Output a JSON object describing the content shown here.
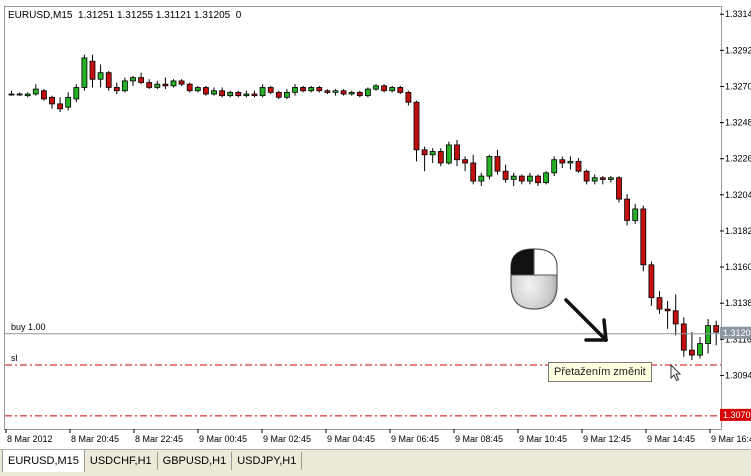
{
  "chart_data": {
    "type": "candlestick",
    "title": "EURUSD,M15  1.31251 1.31255 1.31121 1.31205  0",
    "symbol": "EURUSD",
    "timeframe": "M15",
    "ohlc_info": "1.31251 1.31255 1.31121 1.31205  0",
    "price_ticks": [
      "1.3314",
      "1.3292",
      "1.3270",
      "1.3248",
      "1.3226",
      "1.3204",
      "1.3182",
      "1.3160",
      "1.3138",
      "1.3116",
      "1.3094"
    ],
    "ylim": [
      1.3062,
      1.3319
    ],
    "time_ticks": [
      "8 Mar 2012",
      "8 Mar 20:45",
      "8 Mar 22:45",
      "9 Mar 00:45",
      "9 Mar 02:45",
      "9 Mar 04:45",
      "9 Mar 06:45",
      "9 Mar 08:45",
      "9 Mar 10:45",
      "9 Mar 12:45",
      "9 Mar 14:45",
      "9 Mar 16:45"
    ],
    "candles": [
      [
        1.3266,
        1.3268,
        1.3265,
        1.3266
      ],
      [
        1.3266,
        1.3267,
        1.3265,
        1.3266
      ],
      [
        1.3265,
        1.3267,
        1.3264,
        1.3266
      ],
      [
        1.3266,
        1.3272,
        1.3265,
        1.3269
      ],
      [
        1.3268,
        1.3269,
        1.3262,
        1.3263
      ],
      [
        1.3264,
        1.3265,
        1.3257,
        1.326
      ],
      [
        1.326,
        1.3264,
        1.3255,
        1.3257
      ],
      [
        1.3258,
        1.3267,
        1.3256,
        1.3264
      ],
      [
        1.3263,
        1.3272,
        1.3261,
        1.327
      ],
      [
        1.327,
        1.329,
        1.3268,
        1.3288
      ],
      [
        1.3286,
        1.329,
        1.327,
        1.3275
      ],
      [
        1.3275,
        1.3284,
        1.327,
        1.3279
      ],
      [
        1.3279,
        1.328,
        1.3268,
        1.327
      ],
      [
        1.327,
        1.3273,
        1.3266,
        1.3268
      ],
      [
        1.3268,
        1.3276,
        1.3267,
        1.3274
      ],
      [
        1.3274,
        1.3277,
        1.3271,
        1.3276
      ],
      [
        1.3276,
        1.3279,
        1.3272,
        1.3273
      ],
      [
        1.3273,
        1.3275,
        1.3269,
        1.327
      ],
      [
        1.327,
        1.3274,
        1.3269,
        1.3272
      ],
      [
        1.3272,
        1.3276,
        1.3269,
        1.3271
      ],
      [
        1.3271,
        1.3275,
        1.327,
        1.3274
      ],
      [
        1.3274,
        1.3275,
        1.3271,
        1.3272
      ],
      [
        1.3272,
        1.3273,
        1.3267,
        1.3268
      ],
      [
        1.3268,
        1.3271,
        1.3267,
        1.327
      ],
      [
        1.327,
        1.3271,
        1.3265,
        1.3266
      ],
      [
        1.3266,
        1.327,
        1.3265,
        1.3268
      ],
      [
        1.3268,
        1.327,
        1.3264,
        1.3265
      ],
      [
        1.3265,
        1.3268,
        1.3264,
        1.3267
      ],
      [
        1.3267,
        1.3268,
        1.3264,
        1.3265
      ],
      [
        1.3265,
        1.3268,
        1.3264,
        1.3266
      ],
      [
        1.3266,
        1.3268,
        1.3264,
        1.3265
      ],
      [
        1.3265,
        1.3272,
        1.3264,
        1.327
      ],
      [
        1.327,
        1.3271,
        1.3266,
        1.3267
      ],
      [
        1.3267,
        1.3268,
        1.3263,
        1.3264
      ],
      [
        1.3264,
        1.3269,
        1.3263,
        1.3267
      ],
      [
        1.3267,
        1.3272,
        1.3265,
        1.327
      ],
      [
        1.327,
        1.3271,
        1.3267,
        1.3268
      ],
      [
        1.3268,
        1.3271,
        1.3267,
        1.327
      ],
      [
        1.327,
        1.3271,
        1.3267,
        1.3268
      ],
      [
        1.3268,
        1.3269,
        1.3266,
        1.3267
      ],
      [
        1.3267,
        1.3269,
        1.3265,
        1.3268
      ],
      [
        1.3268,
        1.3269,
        1.3265,
        1.3266
      ],
      [
        1.3266,
        1.3268,
        1.3265,
        1.3267
      ],
      [
        1.3267,
        1.3268,
        1.3264,
        1.3265
      ],
      [
        1.3265,
        1.327,
        1.3264,
        1.3269
      ],
      [
        1.3269,
        1.3272,
        1.3268,
        1.3271
      ],
      [
        1.3271,
        1.3272,
        1.3267,
        1.3268
      ],
      [
        1.3268,
        1.3271,
        1.3267,
        1.327
      ],
      [
        1.327,
        1.3271,
        1.3266,
        1.3267
      ],
      [
        1.3267,
        1.3268,
        1.3259,
        1.3261
      ],
      [
        1.3261,
        1.3262,
        1.3225,
        1.3232
      ],
      [
        1.3232,
        1.3234,
        1.3219,
        1.3229
      ],
      [
        1.3229,
        1.3233,
        1.3224,
        1.3231
      ],
      [
        1.3231,
        1.3233,
        1.3222,
        1.3224
      ],
      [
        1.3224,
        1.3237,
        1.3223,
        1.3235
      ],
      [
        1.3235,
        1.3238,
        1.3222,
        1.3226
      ],
      [
        1.3226,
        1.3228,
        1.3219,
        1.3224
      ],
      [
        1.3224,
        1.3229,
        1.3211,
        1.3213
      ],
      [
        1.3213,
        1.3218,
        1.321,
        1.3216
      ],
      [
        1.3216,
        1.3229,
        1.3214,
        1.3228
      ],
      [
        1.3228,
        1.3232,
        1.3217,
        1.3219
      ],
      [
        1.3219,
        1.3223,
        1.3212,
        1.3214
      ],
      [
        1.3214,
        1.3218,
        1.321,
        1.3216
      ],
      [
        1.3216,
        1.3217,
        1.3211,
        1.3213
      ],
      [
        1.3213,
        1.3218,
        1.3211,
        1.3216
      ],
      [
        1.3216,
        1.3217,
        1.321,
        1.3212
      ],
      [
        1.3212,
        1.3219,
        1.3211,
        1.3218
      ],
      [
        1.3218,
        1.3228,
        1.3216,
        1.3226
      ],
      [
        1.3226,
        1.3228,
        1.3221,
        1.3224
      ],
      [
        1.3224,
        1.3228,
        1.322,
        1.3225
      ],
      [
        1.3225,
        1.3227,
        1.3218,
        1.3219
      ],
      [
        1.3219,
        1.322,
        1.3211,
        1.3213
      ],
      [
        1.3213,
        1.3217,
        1.3211,
        1.3215
      ],
      [
        1.3215,
        1.3216,
        1.3211,
        1.3214
      ],
      [
        1.3214,
        1.3216,
        1.3212,
        1.3215
      ],
      [
        1.3215,
        1.3216,
        1.32,
        1.3202
      ],
      [
        1.3202,
        1.3205,
        1.3186,
        1.3189
      ],
      [
        1.3189,
        1.3199,
        1.3187,
        1.3196
      ],
      [
        1.3196,
        1.3198,
        1.3158,
        1.3162
      ],
      [
        1.3162,
        1.3164,
        1.3137,
        1.3142
      ],
      [
        1.3142,
        1.3146,
        1.3132,
        1.3135
      ],
      [
        1.3135,
        1.314,
        1.3123,
        1.3134
      ],
      [
        1.3134,
        1.3144,
        1.3119,
        1.3126
      ],
      [
        1.3126,
        1.313,
        1.3106,
        1.311
      ],
      [
        1.311,
        1.3121,
        1.3104,
        1.3107
      ],
      [
        1.3107,
        1.3118,
        1.3105,
        1.3114
      ],
      [
        1.3114,
        1.3129,
        1.3108,
        1.3125
      ],
      [
        1.3125,
        1.3128,
        1.3113,
        1.3121
      ]
    ],
    "lines": {
      "buy": {
        "label": "buy 1.00",
        "price": 1.312,
        "axis_label": "1.3120",
        "color": "#8a96a2"
      },
      "sl": {
        "label": "sl",
        "price": 1.3101,
        "color": "#d40000"
      },
      "tp": {
        "price": 1.307,
        "axis_label": "1.3070",
        "color": "#d40000"
      }
    },
    "colors": {
      "bull": "#25b025",
      "bear": "#c21010",
      "outline": "#000000",
      "sl_line": "#d40000"
    }
  },
  "tooltip": {
    "text": "Přetažením změnit"
  },
  "icons": {
    "mouse": "mouse-left-button-icon",
    "arrow": "drag-arrow-icon",
    "cursor": "mouse-pointer-icon"
  },
  "tabs": [
    {
      "label": "EURUSD,M15",
      "active": true
    },
    {
      "label": "USDCHF,H1",
      "active": false
    },
    {
      "label": "GBPUSD,H1",
      "active": false
    },
    {
      "label": "USDJPY,H1",
      "active": false
    }
  ]
}
